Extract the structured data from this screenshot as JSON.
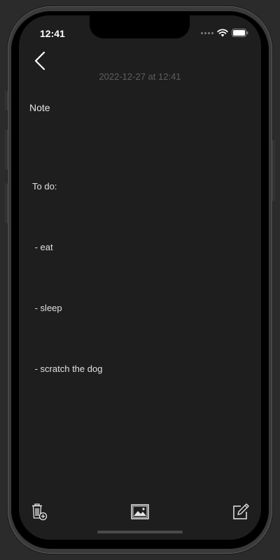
{
  "status_bar": {
    "time": "12:41",
    "icons": [
      "cellular-signal-icon",
      "wifi-icon",
      "battery-icon"
    ]
  },
  "header": {
    "back_icon": "chevron-left-icon",
    "date": "2022-12-27 at 12:41"
  },
  "note": {
    "title": "Note",
    "lines": [
      "To do:",
      " - eat",
      " - sleep",
      " - scratch the dog"
    ]
  },
  "toolbar": {
    "icons": [
      "trash-add-icon",
      "image-icon",
      "compose-icon"
    ]
  },
  "colors": {
    "background": "#1e1e1e",
    "text": "#e0e0e0",
    "muted": "#5e5e5e"
  }
}
